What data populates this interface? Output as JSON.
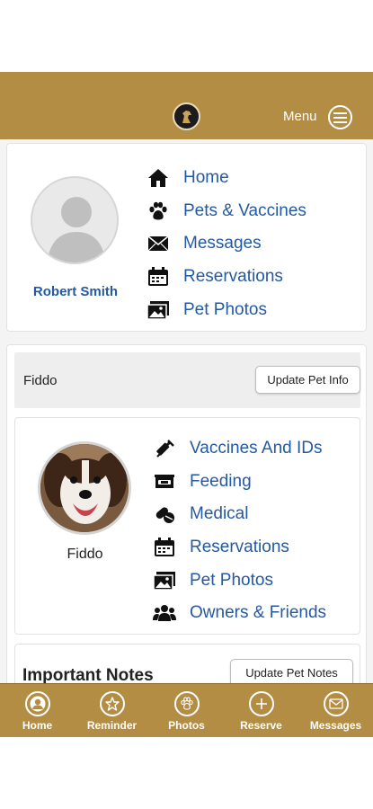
{
  "header": {
    "menu_label": "Menu",
    "logo_icon": "horse-logo-icon"
  },
  "profile": {
    "user_name": "Robert Smith",
    "nav": [
      {
        "label": "Home",
        "icon": "home-icon"
      },
      {
        "label": "Pets & Vaccines",
        "icon": "paw-icon"
      },
      {
        "label": "Messages",
        "icon": "envelope-icon"
      },
      {
        "label": "Reservations",
        "icon": "calendar-icon"
      },
      {
        "label": "Pet Photos",
        "icon": "photo-icon"
      }
    ]
  },
  "pet": {
    "header_name": "Fiddo",
    "update_button": "Update Pet Info",
    "name": "Fiddo",
    "nav": [
      {
        "label": "Vaccines And IDs",
        "icon": "syringe-icon"
      },
      {
        "label": "Feeding",
        "icon": "food-bowl-icon"
      },
      {
        "label": "Medical",
        "icon": "pill-icon"
      },
      {
        "label": "Reservations",
        "icon": "calendar-icon"
      },
      {
        "label": "Pet Photos",
        "icon": "photo-icon"
      },
      {
        "label": "Owners & Friends",
        "icon": "users-icon"
      }
    ]
  },
  "notes": {
    "title": "Important Notes",
    "update_button": "Update Pet Notes"
  },
  "bottom_nav": [
    {
      "label": "Home",
      "icon": "user-circle-icon"
    },
    {
      "label": "Reminder",
      "icon": "star-icon"
    },
    {
      "label": "Photos",
      "icon": "paw-circle-icon"
    },
    {
      "label": "Reserve",
      "icon": "plus-circle-icon"
    },
    {
      "label": "Messages",
      "icon": "envelope-circle-icon"
    }
  ],
  "colors": {
    "brand_gold": "#b48d45",
    "link_blue": "#2459a3"
  }
}
